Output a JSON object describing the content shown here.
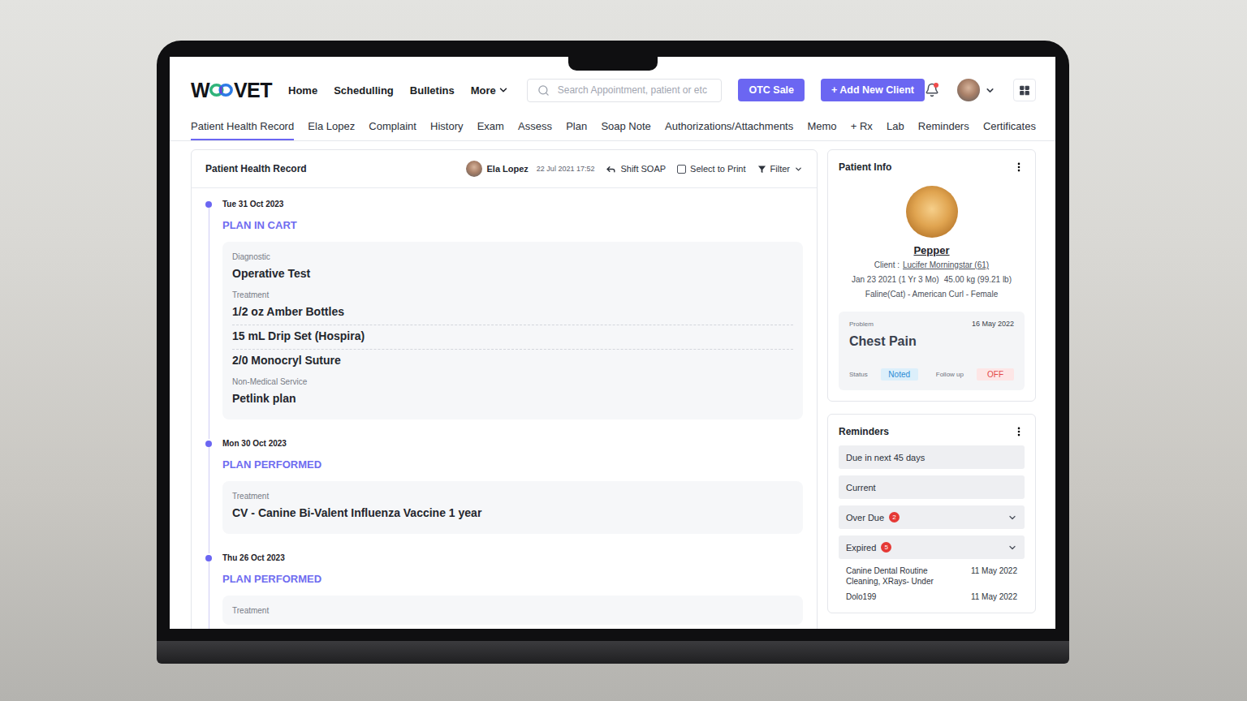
{
  "app": {
    "logo": {
      "left": "W",
      "right": "VET"
    },
    "nav": [
      {
        "label": "Home",
        "dropdown": false
      },
      {
        "label": "Schedulling",
        "dropdown": false
      },
      {
        "label": "Bulletins",
        "dropdown": false
      },
      {
        "label": "More",
        "dropdown": true
      }
    ],
    "search": {
      "placeholder": "Search Appointment, patient or etc"
    },
    "buttons": [
      "OTC Sale",
      "+ Add New Client"
    ],
    "notifications": {
      "unread": true
    }
  },
  "tabs": [
    {
      "label": "Patient Health Record",
      "selected": true
    },
    {
      "label": "Ela Lopez",
      "selected": false
    },
    {
      "label": "Complaint",
      "selected": false
    },
    {
      "label": "History",
      "selected": false
    },
    {
      "label": "Exam",
      "selected": false
    },
    {
      "label": "Assess",
      "selected": false
    },
    {
      "label": "Plan",
      "selected": false
    },
    {
      "label": "Soap Note",
      "selected": false
    },
    {
      "label": "Authorizations/Attachments",
      "selected": false
    },
    {
      "label": "Memo",
      "selected": false
    },
    {
      "label": "+ Rx",
      "selected": false
    },
    {
      "label": "Lab",
      "selected": false
    },
    {
      "label": "Reminders",
      "selected": false
    },
    {
      "label": "Certificates",
      "selected": false
    }
  ],
  "record": {
    "title": "Patient Health Record",
    "author": "Ela Lopez",
    "datetime": "22 Jul 2021 17:52",
    "actions": [
      {
        "label": "Shift SOAP",
        "kind": "button"
      },
      {
        "label": "Select to Print",
        "kind": "checkbox",
        "checked": false
      },
      {
        "label": "Filter",
        "kind": "dropdown"
      }
    ]
  },
  "timeline": [
    {
      "date": "Tue 31 Oct 2023",
      "status": "PLAN IN CART",
      "groups": [
        {
          "label": "Diagnostic",
          "items": [
            "Operative Test"
          ]
        },
        {
          "label": "Treatment",
          "items": [
            "1/2 oz Amber Bottles",
            "15 mL Drip Set (Hospira)",
            "2/0 Monocryl Suture"
          ]
        },
        {
          "label": "Non-Medical Service",
          "items": [
            "Petlink plan"
          ]
        }
      ]
    },
    {
      "date": "Mon 30 Oct 2023",
      "status": "PLAN PERFORMED",
      "groups": [
        {
          "label": "Treatment",
          "items": [
            "CV - Canine Bi-Valent Influenza Vaccine 1 year"
          ]
        }
      ]
    },
    {
      "date": "Thu 26 Oct 2023",
      "status": "PLAN PERFORMED",
      "groups": [
        {
          "label": "Treatment",
          "items": []
        }
      ]
    }
  ],
  "patient": {
    "title": "Patient Info",
    "name": "Pepper",
    "client_label": "Client :",
    "client": "Lucifer Morningstar (61)",
    "dob": "Jan 23 2021 (1 Yr 3 Mo)",
    "weight": "45.00 kg (99.21 lb)",
    "breed": "Faline(Cat) - American Curl - Female",
    "problem": {
      "label": "Problem",
      "date": "16 May 2022",
      "title": "Chest Pain",
      "status_label": "Status",
      "status": "Noted",
      "followup_label": "Follow up",
      "followup": "OFF",
      "followup_on": false
    }
  },
  "reminders": {
    "title": "Reminders",
    "groups": [
      {
        "label": "Due in next 45 days",
        "count": "",
        "expandable": false
      },
      {
        "label": "Current",
        "count": "",
        "expandable": false
      },
      {
        "label": "Over Due",
        "count": "2",
        "expandable": true
      },
      {
        "label": "Expired",
        "count": "5",
        "expandable": true
      }
    ],
    "items": [
      {
        "name": "Canine Dental Routine Cleaning, XRays- Under",
        "date": "11 May 2022"
      },
      {
        "name": "Dolo199",
        "date": "11 May 2022"
      }
    ]
  }
}
